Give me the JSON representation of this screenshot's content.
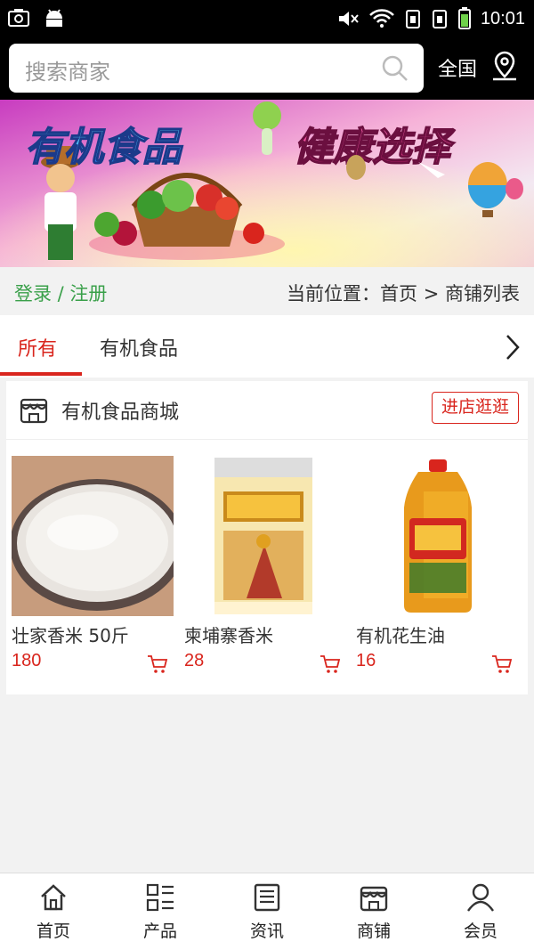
{
  "status_bar": {
    "time": "10:01"
  },
  "search": {
    "placeholder": "搜索商家"
  },
  "region": {
    "label": "全国"
  },
  "banner": {
    "title_left": "有机食品",
    "title_right": "健康选择"
  },
  "location_bar": {
    "login": "登录 / 注册",
    "breadcrumb": "当前位置：首页 > 商铺列表"
  },
  "tabs": [
    {
      "label": "所有",
      "active": true
    },
    {
      "label": "有机食品",
      "active": false
    }
  ],
  "store": {
    "name": "有机食品商城",
    "visit_label": "进店逛逛",
    "products": [
      {
        "name": "壮家香米 50斤",
        "price": "180"
      },
      {
        "name": "柬埔寨香米",
        "price": "28"
      },
      {
        "name": "有机花生油",
        "price": "16"
      }
    ]
  },
  "bottom_nav": [
    {
      "label": "首页",
      "icon": "home-icon"
    },
    {
      "label": "产品",
      "icon": "grid-list-icon"
    },
    {
      "label": "资讯",
      "icon": "news-icon"
    },
    {
      "label": "商铺",
      "icon": "store-icon"
    },
    {
      "label": "会员",
      "icon": "user-icon"
    }
  ],
  "colors": {
    "accent": "#d9251d",
    "login_green": "#3aa04a"
  }
}
